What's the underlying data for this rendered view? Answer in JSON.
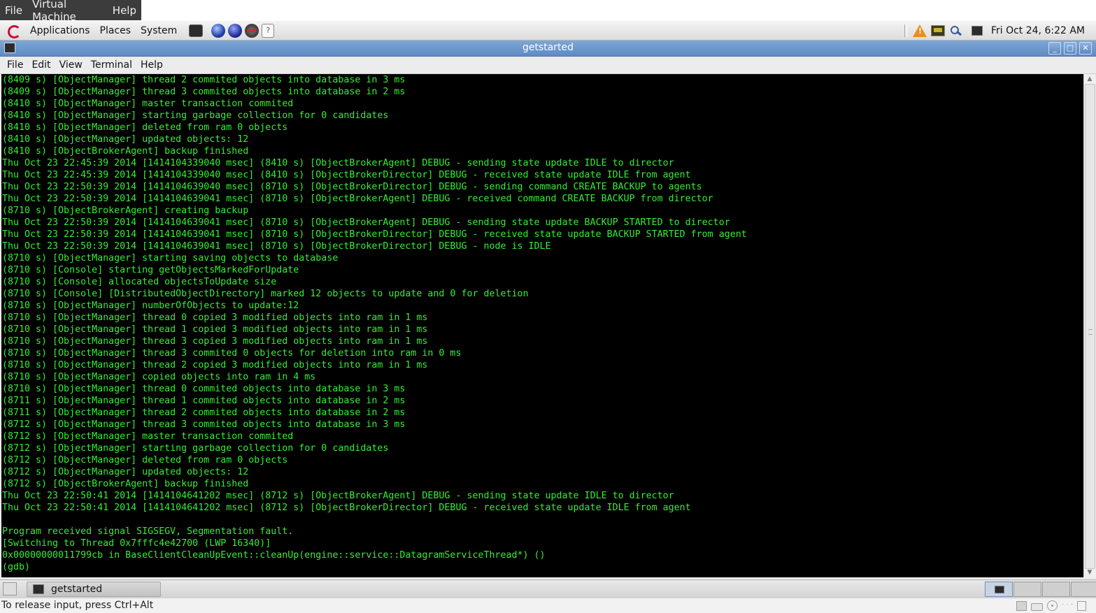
{
  "vm_menubar": {
    "items": [
      "File",
      "Virtual Machine",
      "Help"
    ]
  },
  "top_panel": {
    "menus": [
      "Applications",
      "Places",
      "System"
    ],
    "launchers": [
      "terminal-launcher-icon",
      "web-browser-icon",
      "eclipse-icon",
      "media-record-icon",
      "help-icon"
    ],
    "tray_icons": [
      "warning-icon",
      "display-icon",
      "keyring-icon",
      "terminal-tray-icon"
    ],
    "clock": "Fri Oct 24,  6:22 AM"
  },
  "window": {
    "title": "getstarted",
    "buttons": [
      "minimize",
      "maximize",
      "close"
    ]
  },
  "terminal_menu": [
    "File",
    "Edit",
    "View",
    "Terminal",
    "Help"
  ],
  "terminal": {
    "fg_color": "#33ee33",
    "bg_color": "#000000",
    "lines": [
      "(8409 s) [ObjectManager] thread 2 commited objects into database in 3 ms",
      "(8409 s) [ObjectManager] thread 3 commited objects into database in 2 ms",
      "(8410 s) [ObjectManager] master transaction commited",
      "(8410 s) [ObjectManager] starting garbage collection for 0 candidates",
      "(8410 s) [ObjectManager] deleted from ram 0 objects",
      "(8410 s) [ObjectManager] updated objects: 12",
      "(8410 s) [ObjectBrokerAgent] backup finished",
      "Thu Oct 23 22:45:39 2014 [1414104339040 msec] (8410 s) [ObjectBrokerAgent] DEBUG - sending state update IDLE to director",
      "Thu Oct 23 22:45:39 2014 [1414104339040 msec] (8410 s) [ObjectBrokerDirector] DEBUG - received state update IDLE from agent",
      "Thu Oct 23 22:50:39 2014 [1414104639040 msec] (8710 s) [ObjectBrokerDirector] DEBUG - sending command CREATE BACKUP to agents",
      "Thu Oct 23 22:50:39 2014 [1414104639041 msec] (8710 s) [ObjectBrokerAgent] DEBUG - received command CREATE BACKUP from director",
      "(8710 s) [ObjectBrokerAgent] creating backup",
      "Thu Oct 23 22:50:39 2014 [1414104639041 msec] (8710 s) [ObjectBrokerAgent] DEBUG - sending state update BACKUP STARTED to director",
      "Thu Oct 23 22:50:39 2014 [1414104639041 msec] (8710 s) [ObjectBrokerDirector] DEBUG - received state update BACKUP STARTED from agent",
      "Thu Oct 23 22:50:39 2014 [1414104639041 msec] (8710 s) [ObjectBrokerDirector] DEBUG - node is IDLE",
      "(8710 s) [ObjectManager] starting saving objects to database",
      "(8710 s) [Console] starting getObjectsMarkedForUpdate",
      "(8710 s) [Console] allocated objectsToUpdate size",
      "(8710 s) [Console] [DistributedObjectDirectory] marked 12 objects to update and 0 for deletion",
      "(8710 s) [ObjectManager] numberOfObjects to update:12",
      "(8710 s) [ObjectManager] thread 0 copied 3 modified objects into ram in 1 ms",
      "(8710 s) [ObjectManager] thread 1 copied 3 modified objects into ram in 1 ms",
      "(8710 s) [ObjectManager] thread 3 copied 3 modified objects into ram in 1 ms",
      "(8710 s) [ObjectManager] thread 3 commited 0 objects for deletion into ram in 0 ms",
      "(8710 s) [ObjectManager] thread 2 copied 3 modified objects into ram in 1 ms",
      "(8710 s) [ObjectManager] copied objects into ram in 4 ms",
      "(8710 s) [ObjectManager] thread 0 commited objects into database in 3 ms",
      "(8711 s) [ObjectManager] thread 1 commited objects into database in 2 ms",
      "(8711 s) [ObjectManager] thread 2 commited objects into database in 2 ms",
      "(8712 s) [ObjectManager] thread 3 commited objects into database in 3 ms",
      "(8712 s) [ObjectManager] master transaction commited",
      "(8712 s) [ObjectManager] starting garbage collection for 0 candidates",
      "(8712 s) [ObjectManager] deleted from ram 0 objects",
      "(8712 s) [ObjectManager] updated objects: 12",
      "(8712 s) [ObjectBrokerAgent] backup finished",
      "Thu Oct 23 22:50:41 2014 [1414104641202 msec] (8712 s) [ObjectBrokerAgent] DEBUG - sending state update IDLE to director",
      "Thu Oct 23 22:50:41 2014 [1414104641202 msec] (8712 s) [ObjectBrokerDirector] DEBUG - received state update IDLE from agent",
      "",
      "Program received signal SIGSEGV, Segmentation fault.",
      "[Switching to Thread 0x7fffc4e42700 (LWP 16340)]",
      "0x00000000011799cb in BaseClientCleanUpEvent::cleanUp(engine::service::DatagramServiceThread*) ()",
      "(gdb) "
    ]
  },
  "bottom_panel": {
    "task_label": "getstarted",
    "workspaces": 4,
    "active_workspace": 1
  },
  "vm_status": {
    "text": "To release input, press Ctrl+Alt"
  }
}
